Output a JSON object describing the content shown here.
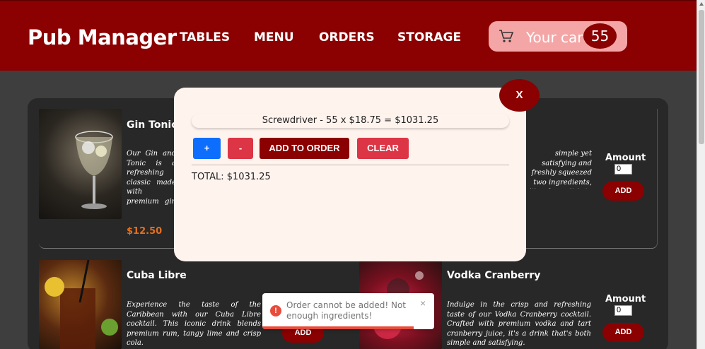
{
  "header": {
    "brand": "Pub Manager",
    "nav": [
      "TABLES",
      "MENU",
      "ORDERS",
      "STORAGE"
    ],
    "cart_label": "Your cart",
    "cart_count": "55",
    "bg_color": "#8b0000"
  },
  "menu_items": [
    {
      "title": "Gin Tonic",
      "desc": "Our Gin and Tonic is a refreshing classic made with premium gin and tonic water, served over ice with a slice of lime. This crisp and timeless cocktail is known for its clean, botanical flavour and a favorite.",
      "price": "$12.50"
    },
    {
      "title": "",
      "desc": "simple yet satisfying and freshly squeezed two ingredients, it's a ke as it is to enjoy.",
      "amount_label": "Amount",
      "amount_value": "0",
      "add_label": "ADD"
    },
    {
      "title": "Cuba Libre",
      "desc": "Experience the taste of the Caribbean with our Cuba Libre cocktail. This iconic drink blends premium rum, tangy lime and crisp cola.",
      "add_label": "ADD"
    },
    {
      "title": "Vodka Cranberry",
      "desc": "Indulge in the crisp and refreshing taste of our Vodka Cranberry cocktail. Crafted with premium vodka and tart cranberry juice, it's a drink that's both simple and satisfying.",
      "amount_label": "Amount",
      "amount_value": "0",
      "add_label": "ADD"
    }
  ],
  "modal": {
    "close_label": "X",
    "order_line": "Screwdriver - 55 x $18.75 = $1031.25",
    "plus_label": "+",
    "minus_label": "-",
    "add_to_order_label": "ADD TO ORDER",
    "clear_label": "CLEAR",
    "total": "TOTAL: $1031.25"
  },
  "toast": {
    "icon": "!",
    "message": "Order cannot be added! Not enough ingredients!",
    "close": "×",
    "progress": 0.88
  }
}
